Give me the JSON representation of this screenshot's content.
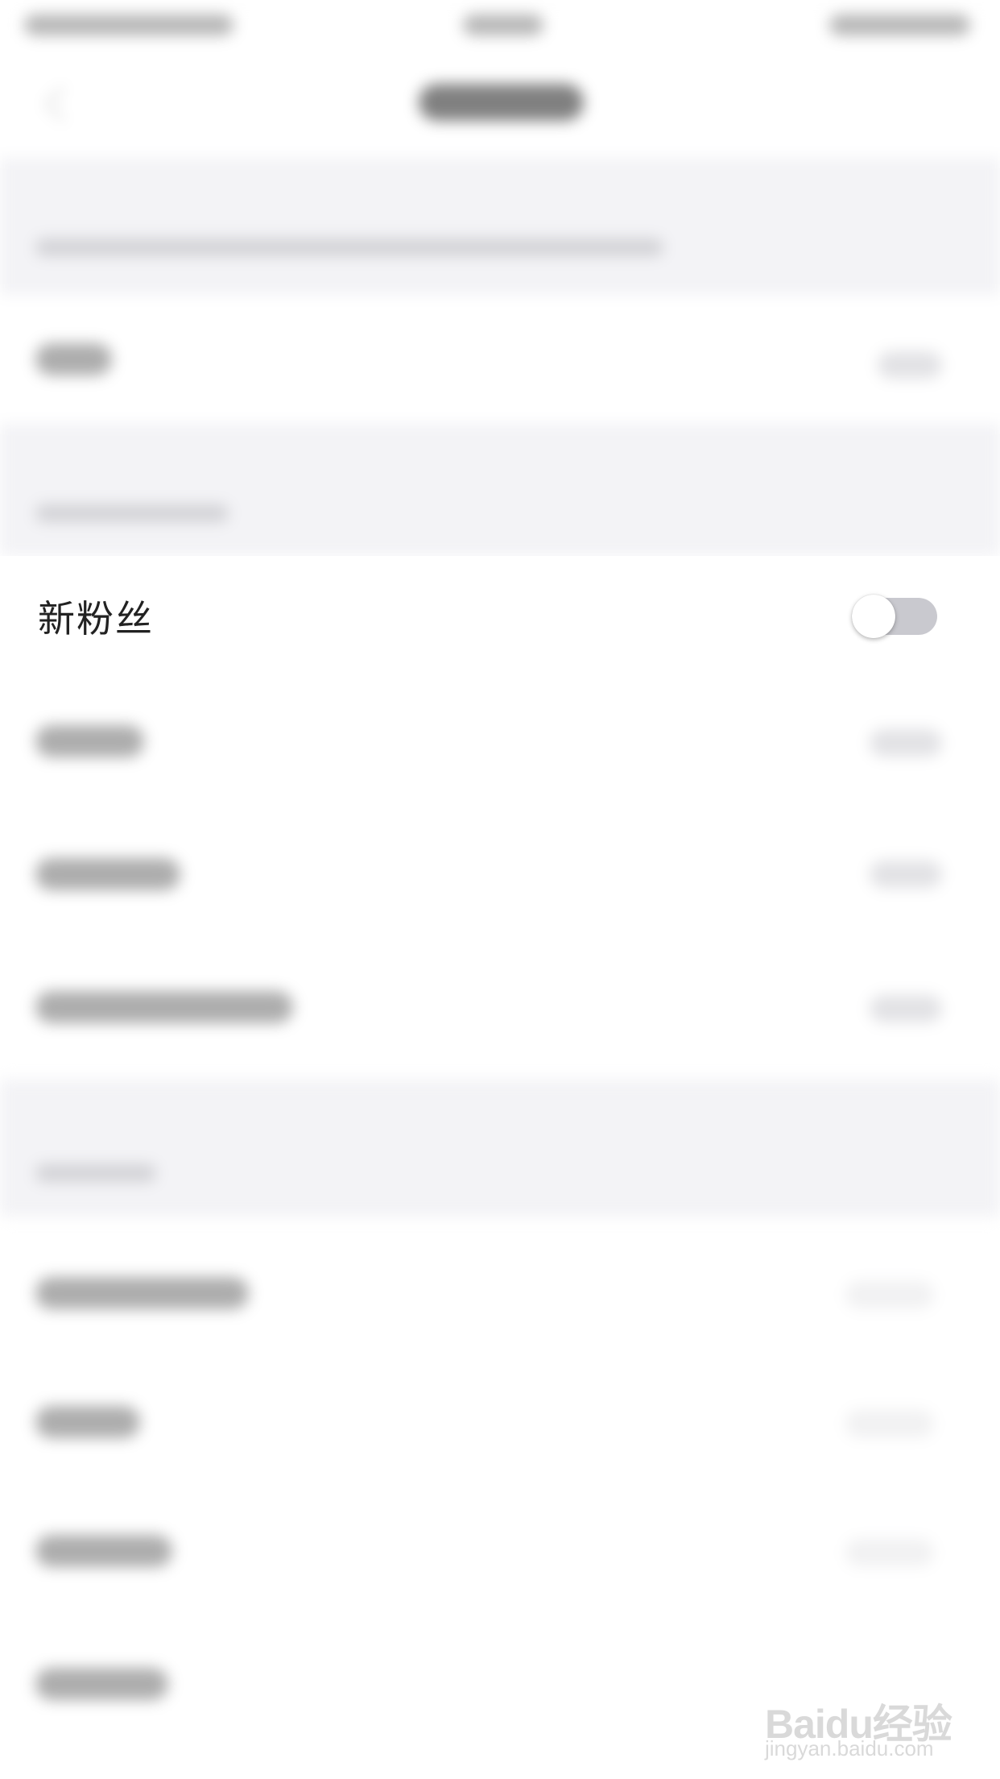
{
  "settings": {
    "new_followers_label": "新粉丝",
    "new_followers_enabled": false
  },
  "colors": {
    "toggle_off_track": "#c9c9cf",
    "toggle_knob": "#ffffff",
    "section_background": "#f3f3f6",
    "label_text": "#222222"
  },
  "watermark": {
    "logo": "Baidu经验",
    "url": "jingyan.baidu.com"
  }
}
